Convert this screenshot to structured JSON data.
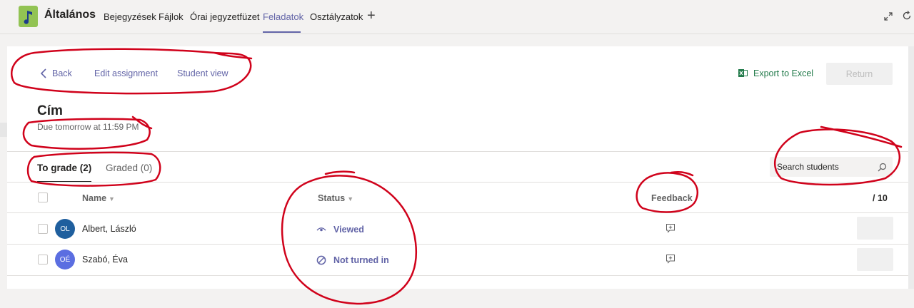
{
  "header": {
    "team_name": "Általános",
    "tabs": [
      {
        "label": "Bejegyzések",
        "active": false
      },
      {
        "label": "Fájlok",
        "active": false
      },
      {
        "label": "Órai jegyzetfüzet",
        "active": false
      },
      {
        "label": "Feladatok",
        "active": true
      },
      {
        "label": "Osztályzatok",
        "active": false
      }
    ],
    "add_tab_icon": "plus-icon",
    "expand_icon": "expand-icon",
    "refresh_icon": "refresh-icon"
  },
  "commands": {
    "back_label": "Back",
    "edit_label": "Edit assignment",
    "student_view_label": "Student view",
    "export_label": "Export to Excel",
    "return_label": "Return"
  },
  "assignment": {
    "title": "Cím",
    "due": "Due tomorrow at 11:59 PM"
  },
  "subtabs": {
    "to_grade": "To grade (2)",
    "graded": "Graded (0)"
  },
  "search": {
    "placeholder": "Search students"
  },
  "table": {
    "headers": {
      "name": "Name",
      "status": "Status",
      "feedback": "Feedback",
      "points": "/ 10"
    },
    "rows": [
      {
        "initials": "OL",
        "avatar_color": "#1f5f9e",
        "name": "Albert, László",
        "status": "Viewed",
        "status_icon": "eye-icon"
      },
      {
        "initials": "OÉ",
        "avatar_color": "#5b6ee1",
        "name": "Szabó, Éva",
        "status": "Not turned in",
        "status_icon": "not-allowed-icon"
      }
    ]
  },
  "colors": {
    "accent": "#6264a7",
    "excel": "#237b4b",
    "annotation": "#d0021b"
  }
}
